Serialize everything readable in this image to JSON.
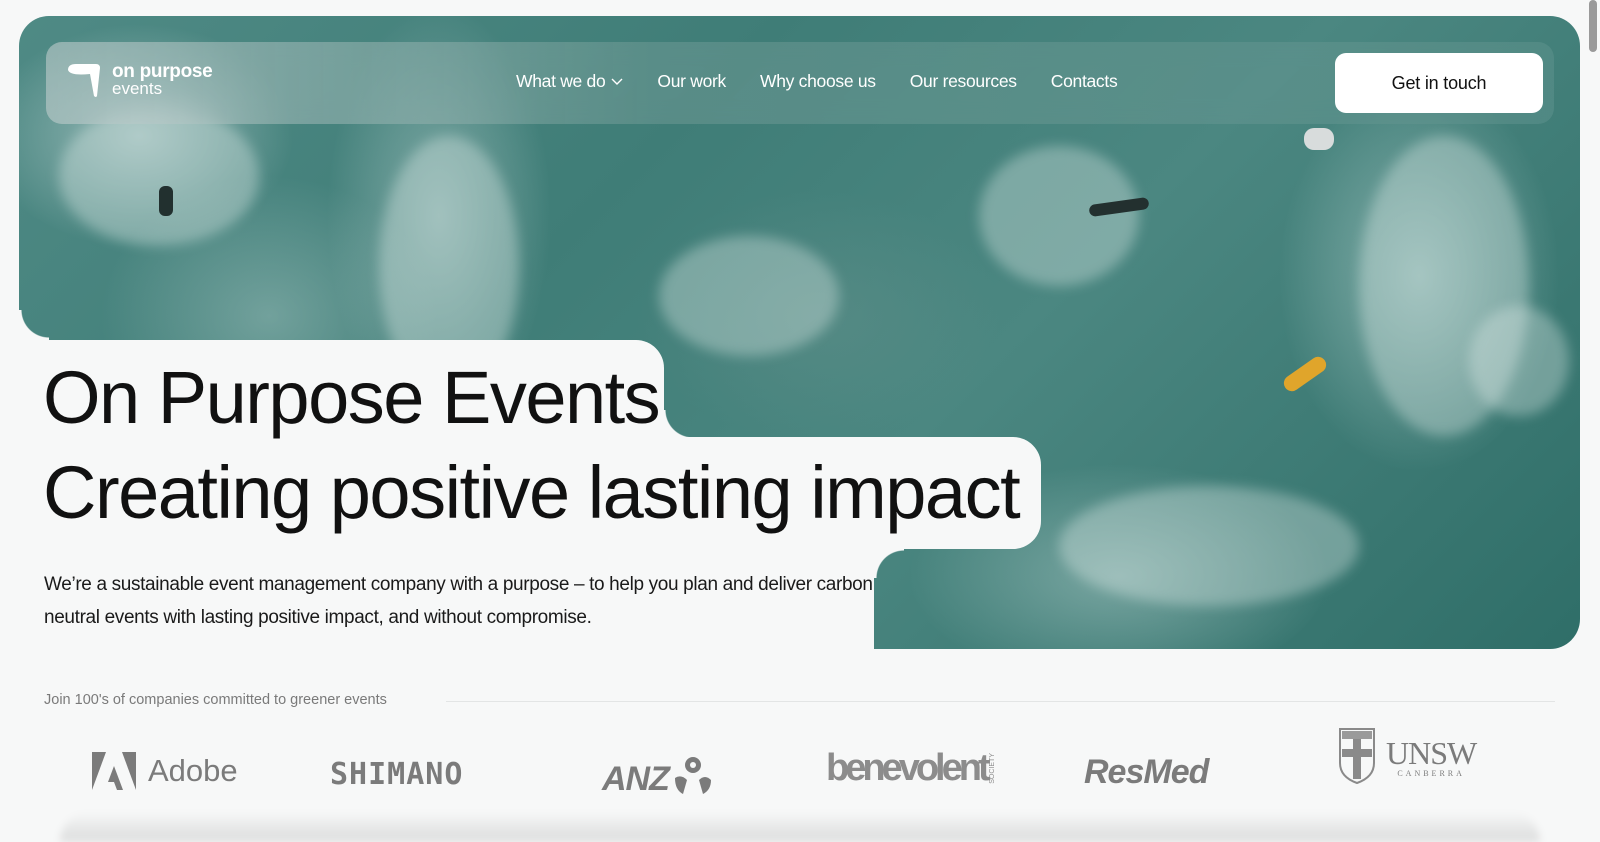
{
  "nav": {
    "logo": {
      "line1": "on purpose",
      "line2": "events"
    },
    "items": [
      {
        "label": "What we do",
        "has_dropdown": true
      },
      {
        "label": "Our work"
      },
      {
        "label": "Why choose us"
      },
      {
        "label": "Our resources"
      },
      {
        "label": "Contacts"
      }
    ],
    "cta_label": "Get in touch"
  },
  "hero": {
    "title": "On Purpose Events",
    "subtitle": "Creating positive lasting impact",
    "description": "We’re a sustainable event management company with a purpose – to help you plan and deliver carbon neutral events with lasting positive impact, and without compromise."
  },
  "clients": {
    "heading": "Join 100's of companies committed to greener events",
    "logos": [
      {
        "name": "Adobe",
        "text": "Adobe"
      },
      {
        "name": "Shimano",
        "text": "SHIMANO"
      },
      {
        "name": "ANZ",
        "text": "ANZ"
      },
      {
        "name": "Benevolent Society",
        "text": "benevolent",
        "sub": "SOCIETY"
      },
      {
        "name": "ResMed",
        "text": "ResMed"
      },
      {
        "name": "UNSW Canberra",
        "text": "UNSW",
        "sub": "CANBERRA"
      }
    ]
  },
  "colors": {
    "hero_teal": "#3f7d77",
    "background": "#f7f8f8",
    "text": "#111111",
    "logo_gray": "#7b7b7b"
  }
}
